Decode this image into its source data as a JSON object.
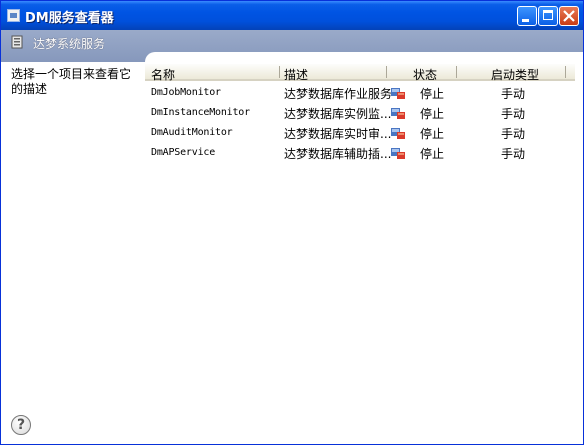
{
  "window": {
    "title": "DM服务查看器"
  },
  "band": {
    "title": "达梦系统服务"
  },
  "left_pane": {
    "description_hint": "选择一个项目来查看它的描述"
  },
  "columns": [
    {
      "label": "名称"
    },
    {
      "label": "描述"
    },
    {
      "label": "状态"
    },
    {
      "label": "启动类型"
    }
  ],
  "services": [
    {
      "name": "DmJobMonitor",
      "description": "达梦数据库作业服务",
      "status": "停止",
      "startup": "手动"
    },
    {
      "name": "DmInstanceMonitor",
      "description": "达梦数据库实例监...",
      "status": "停止",
      "startup": "手动"
    },
    {
      "name": "DmAuditMonitor",
      "description": "达梦数据库实时审...",
      "status": "停止",
      "startup": "手动"
    },
    {
      "name": "DmAPService",
      "description": "达梦数据库辅助插...",
      "status": "停止",
      "startup": "手动"
    }
  ],
  "icons": {
    "window": "app-window-icon",
    "band": "services-icon",
    "status": "service-stopped-icon",
    "help": "help-icon"
  },
  "colors": {
    "titlebar": "#0054e3",
    "band": "#8e9fc2",
    "close_button": "#d9582b"
  }
}
